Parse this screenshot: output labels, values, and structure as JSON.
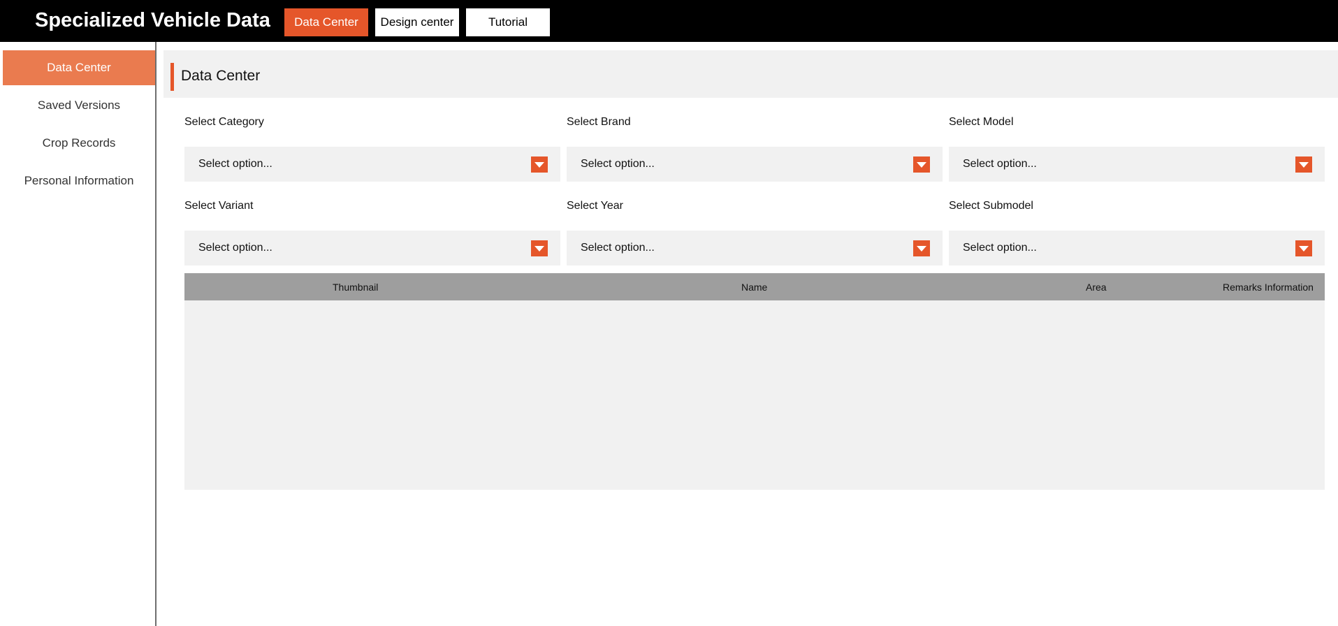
{
  "app": {
    "title": "Specialized Vehicle Data"
  },
  "top_nav": {
    "tabs": [
      {
        "label": "Data Center",
        "active": true
      },
      {
        "label": "Design center",
        "active": false
      },
      {
        "label": "Tutorial",
        "active": false
      }
    ]
  },
  "sidebar": {
    "items": [
      {
        "label": "Data Center",
        "active": true
      },
      {
        "label": "Saved Versions",
        "active": false
      },
      {
        "label": "Crop Records",
        "active": false
      },
      {
        "label": "Personal Information",
        "active": false
      }
    ]
  },
  "main": {
    "title": "Data Center",
    "filters": [
      {
        "label": "Select Category",
        "value": "Select option..."
      },
      {
        "label": "Select Brand",
        "value": "Select option..."
      },
      {
        "label": "Select Model",
        "value": "Select option..."
      },
      {
        "label": "Select Variant",
        "value": "Select option..."
      },
      {
        "label": "Select Year",
        "value": "Select option..."
      },
      {
        "label": "Select Submodel",
        "value": "Select option..."
      }
    ],
    "table": {
      "columns": [
        "Thumbnail",
        "Name",
        "Area",
        "Remarks Information"
      ],
      "rows": []
    }
  },
  "colors": {
    "accent": "#e5562a",
    "sidebar_active": "#ea7b4f",
    "topbar": "#000000",
    "panel": "#f1f1f1",
    "table_header": "#9e9e9e"
  },
  "icons": {
    "dropdown": "chevron-down-icon"
  }
}
